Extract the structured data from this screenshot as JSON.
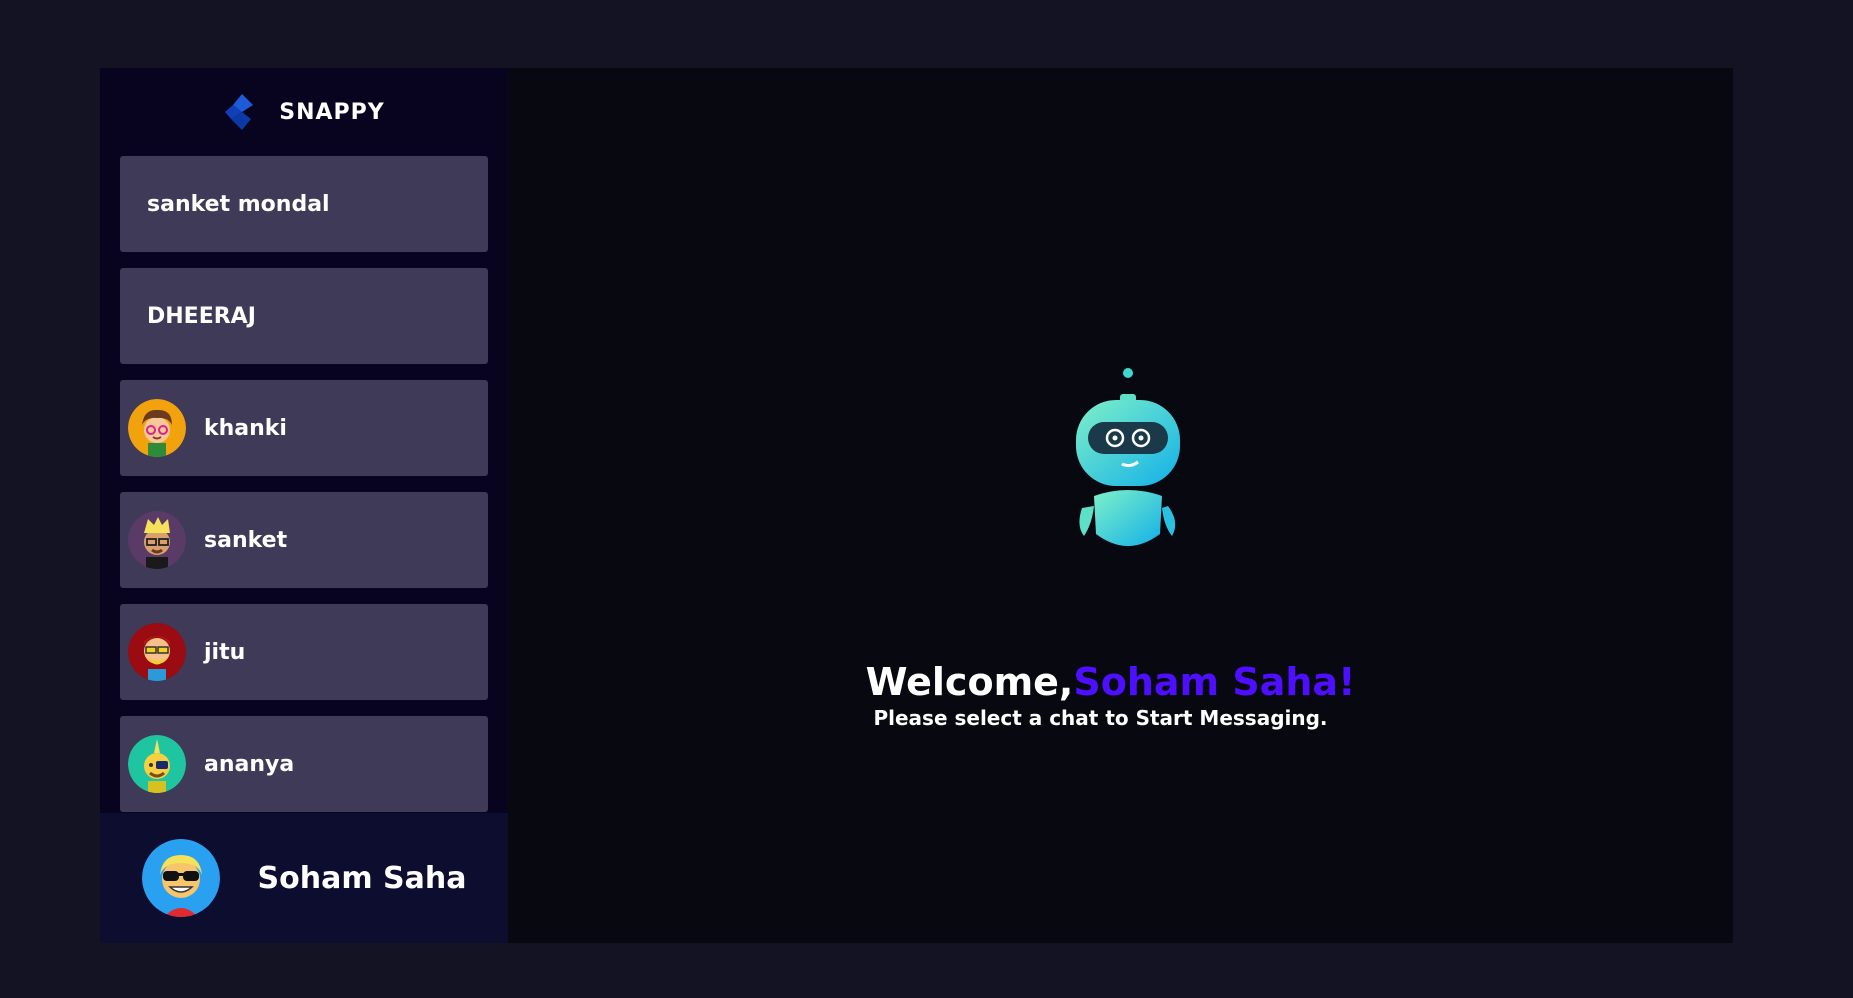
{
  "brand": {
    "name": "SNAPPY",
    "icon": "snappy-logo-icon",
    "accent": "#4e0eff"
  },
  "contacts": [
    {
      "name": "sanket mondal",
      "avatar": "none"
    },
    {
      "name": "DHEERAJ",
      "avatar": "none"
    },
    {
      "name": "khanki",
      "avatar": "curly-hair-glasses-avatar-icon",
      "color": "#f2a20c"
    },
    {
      "name": "sanket",
      "avatar": "blonde-glasses-avatar-icon",
      "color": "#5a3a67"
    },
    {
      "name": "jitu",
      "avatar": "bearded-glasses-avatar-icon",
      "color": "#9b0b12"
    },
    {
      "name": "ananya",
      "avatar": "mohawk-eyepatch-avatar-icon",
      "color": "#1fc5a0"
    }
  ],
  "current_user": {
    "name": "Soham Saha",
    "avatar": "sunglasses-avatar-icon",
    "color": "#2aa0f0"
  },
  "welcome": {
    "greeting": "Welcome,",
    "username": "Soham Saha!",
    "subtitle": "Please select a chat to Start Messaging."
  }
}
